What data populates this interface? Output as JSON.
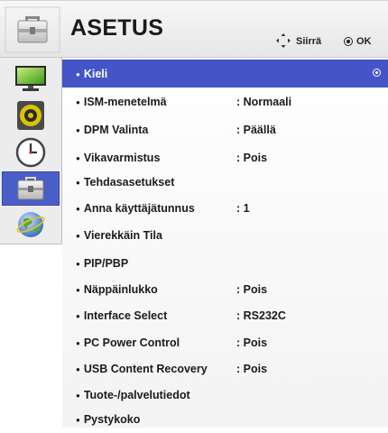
{
  "header": {
    "title": "ASETUS",
    "nav_hint": "Siirrä",
    "ok_hint": "OK",
    "icon": "toolbox-icon"
  },
  "sidebar": {
    "items": [
      {
        "icon": "monitor-picture-icon",
        "active": false
      },
      {
        "icon": "speaker-audio-icon",
        "active": false
      },
      {
        "icon": "clock-time-icon",
        "active": false
      },
      {
        "icon": "toolbox-setup-icon",
        "active": true
      },
      {
        "icon": "globe-network-icon",
        "active": false
      }
    ]
  },
  "menu": {
    "items": [
      {
        "label": "Kieli",
        "value": "",
        "selected": true
      },
      {
        "label": "ISM-menetelmä",
        "value": ": Normaali"
      },
      {
        "label": "DPM Valinta",
        "value": ": Päällä"
      },
      {
        "label": "Vikavarmistus",
        "value": ": Pois"
      },
      {
        "label": "Tehdasasetukset",
        "value": ""
      },
      {
        "label": "Anna käyttäjätunnus",
        "value": ": 1"
      },
      {
        "label": "Vierekkäin Tila",
        "value": ""
      },
      {
        "label": "PIP/PBP",
        "value": ""
      },
      {
        "label": "Näppäinlukko",
        "value": ": Pois"
      },
      {
        "label": "Interface Select",
        "value": ": RS232C"
      },
      {
        "label": "PC Power Control",
        "value": ": Pois"
      },
      {
        "label": "USB Content Recovery",
        "value": ": Pois"
      },
      {
        "label": "Tuote-/palvelutiedot",
        "value": ""
      },
      {
        "label": "Pystykoko",
        "value": ""
      }
    ]
  },
  "colors": {
    "selected_row": "#4455c7",
    "active_sidebar": "#4a5ec8",
    "header_bg": "#eeeeee"
  }
}
